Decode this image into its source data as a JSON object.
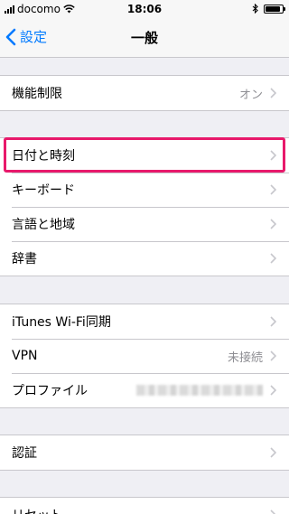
{
  "status_bar": {
    "carrier": "docomo",
    "time": "18:06",
    "signal_icon": "signal-bars-icon",
    "wifi_icon": "wifi-icon",
    "bluetooth_icon": "bluetooth-icon",
    "battery_icon": "battery-icon",
    "battery_level": 0.9
  },
  "nav": {
    "back_label": "設定",
    "title": "一般"
  },
  "groups": [
    {
      "rows": [
        {
          "label": "機能制限",
          "value": "オン"
        }
      ]
    },
    {
      "rows": [
        {
          "label": "日付と時刻",
          "highlighted": true
        },
        {
          "label": "キーボード"
        },
        {
          "label": "言語と地域"
        },
        {
          "label": "辞書"
        }
      ]
    },
    {
      "rows": [
        {
          "label": "iTunes Wi-Fi同期"
        },
        {
          "label": "VPN",
          "value": "未接続"
        },
        {
          "label": "プロファイル",
          "value_obscured": true
        }
      ]
    },
    {
      "rows": [
        {
          "label": "認証"
        }
      ]
    },
    {
      "rows": [
        {
          "label": "リセット"
        }
      ]
    }
  ],
  "colors": {
    "accent": "#007aff",
    "highlight": "#e8196b",
    "background": "#efeff4",
    "separator": "#c8c7cc",
    "secondary_text": "#8e8e93"
  }
}
